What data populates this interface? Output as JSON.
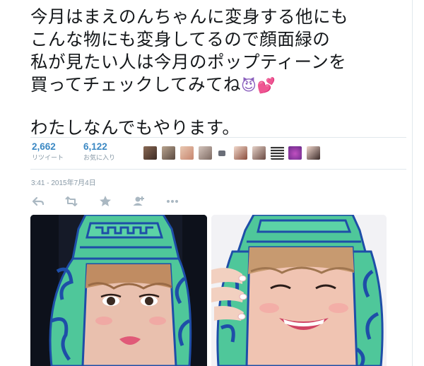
{
  "tweet": {
    "text_lines": [
      "今月はまえのんちゃんに変身する他にも",
      "こんな物にも変身してるので顔面緑の",
      "私が見たい人は今月のポップティーンを",
      "買ってチェックしてみてね"
    ],
    "text_line_last": "わたしなんでもやります。",
    "emoji_devil": "😈",
    "emoji_hearts": "💕"
  },
  "stats": {
    "retweets": {
      "count": "2,662",
      "label": "リツイート"
    },
    "favorites": {
      "count": "6,122",
      "label": "お気に入り"
    }
  },
  "favoriters_avatars": [
    "avatar",
    "avatar",
    "avatar",
    "avatar",
    "avatar",
    "avatar",
    "avatar",
    "avatar",
    "avatar",
    "avatar"
  ],
  "timestamp": "3:41 - 2015年7月4日",
  "actions": [
    "reply-icon",
    "retweet-icon",
    "favorite-icon",
    "follow-icon",
    "more-icon"
  ],
  "colors": {
    "link_blue": "#3b88c3",
    "muted_gray": "#8899a6",
    "icon_gray": "#aab8c2",
    "border": "#e1e8ed",
    "mask_green": "#4fc79a",
    "mask_blue": "#1e4ea8"
  }
}
